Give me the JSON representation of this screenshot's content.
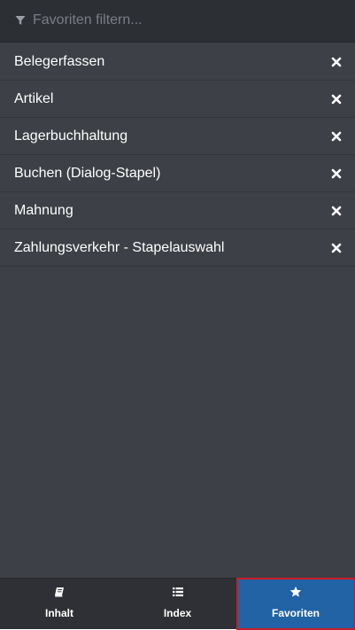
{
  "filter": {
    "placeholder": "Favoriten filtern...",
    "value": ""
  },
  "favorites": [
    {
      "label": "Belegerfassen"
    },
    {
      "label": "Artikel"
    },
    {
      "label": "Lagerbuchhaltung"
    },
    {
      "label": "Buchen (Dialog-Stapel)"
    },
    {
      "label": "Mahnung"
    },
    {
      "label": "Zahlungsverkehr - Stapelauswahl"
    }
  ],
  "tabs": [
    {
      "label": "Inhalt",
      "icon": "book-icon"
    },
    {
      "label": "Index",
      "icon": "list-icon"
    },
    {
      "label": "Favoriten",
      "icon": "star-icon",
      "active": true
    }
  ],
  "colors": {
    "panel_bg": "#3d4046",
    "header_bg": "#2c2f34",
    "tabbar_bg": "#2e3035",
    "active_tab_bg": "#2163a4",
    "active_tab_outline": "#d11a24"
  }
}
